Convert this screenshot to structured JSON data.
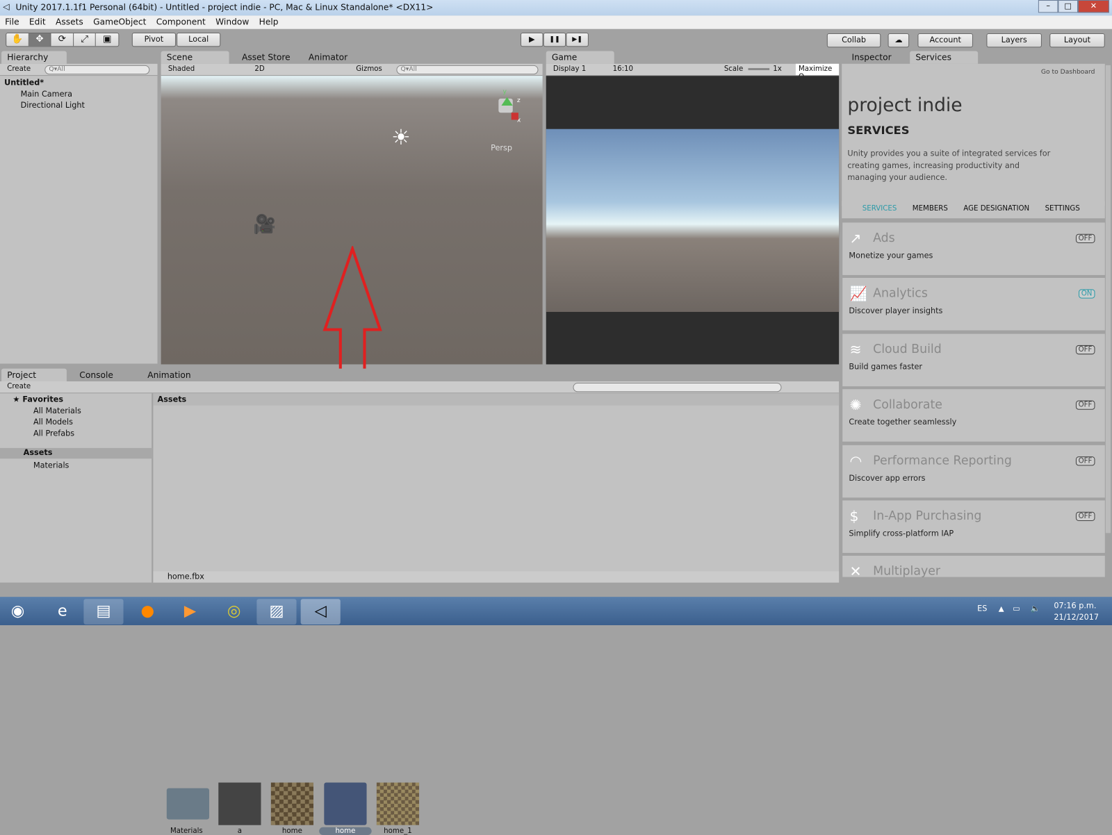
{
  "window": {
    "title": "Unity 2017.1.1f1 Personal (64bit) - Untitled - project indie - PC, Mac & Linux Standalone* <DX11>",
    "controls": [
      "–",
      "□",
      "✕"
    ]
  },
  "menu": [
    "File",
    "Edit",
    "Assets",
    "GameObject",
    "Component",
    "Window",
    "Help"
  ],
  "toolbar": {
    "tools": [
      "✋",
      "✥",
      "⟳",
      "⤢",
      "▣"
    ],
    "pivot": "Pivot",
    "local": "Local",
    "play": "▶",
    "pause": "❚❚",
    "step": "▶❚",
    "collab": "Collab",
    "cloud": "☁",
    "account": "Account",
    "layers": "Layers",
    "layout": "Layout"
  },
  "hierarchy": {
    "tab": "Hierarchy",
    "create": "Create",
    "search": "Q▾All",
    "scene": "Untitled*",
    "items": [
      "Main Camera",
      "Directional Light"
    ]
  },
  "scene": {
    "tabs": [
      "Scene",
      "Asset Store",
      "Animator"
    ],
    "shading": "Shaded",
    "mode2d": "2D",
    "gizmos": "Gizmos",
    "search": "Q▾All",
    "persp": "Persp",
    "axes": {
      "y": "y",
      "z": "z",
      "x": "x"
    }
  },
  "game": {
    "tab": "Game",
    "display": "Display 1",
    "aspect": "16:10",
    "scale_label": "Scale",
    "scale_value": "1x",
    "maximize": "Maximize O"
  },
  "project": {
    "tabs": [
      "Project",
      "Console",
      "Animation"
    ],
    "create": "Create",
    "favorites": "Favorites",
    "fav_items": [
      "All Materials",
      "All Models",
      "All Prefabs"
    ],
    "assets_root": "Assets",
    "folders": [
      "Materials"
    ],
    "breadcrumb": "Assets",
    "assets": [
      {
        "name": "Materials",
        "kind": "folder"
      },
      {
        "name": "a",
        "kind": "texture"
      },
      {
        "name": "home",
        "kind": "texture"
      },
      {
        "name": "home",
        "kind": "model",
        "selected": true
      },
      {
        "name": "home_1",
        "kind": "texture"
      }
    ],
    "status": "home.fbx"
  },
  "services": {
    "tabs": [
      "Inspector",
      "Services"
    ],
    "dashboard": "Go to Dashboard",
    "project": "project indie",
    "heading": "SERVICES",
    "description": "Unity provides you a suite of integrated services for creating games, increasing productivity and managing your audience.",
    "nav": [
      "SERVICES",
      "MEMBERS",
      "AGE DESIGNATION",
      "SETTINGS"
    ],
    "accent": "#2a9aa8",
    "cards": [
      {
        "name": "Ads",
        "desc": "Monetize your games",
        "state": "OFF",
        "icon": "ads-icon",
        "glyph": "↗"
      },
      {
        "name": "Analytics",
        "desc": "Discover player insights",
        "state": "ON",
        "icon": "analytics-icon",
        "glyph": "📈"
      },
      {
        "name": "Cloud Build",
        "desc": "Build games faster",
        "state": "OFF",
        "icon": "cloud-build-icon",
        "glyph": "≋"
      },
      {
        "name": "Collaborate",
        "desc": "Create together seamlessly",
        "state": "OFF",
        "icon": "collaborate-icon",
        "glyph": "✺"
      },
      {
        "name": "Performance Reporting",
        "desc": "Discover app errors",
        "state": "OFF",
        "icon": "performance-icon",
        "glyph": "◠"
      },
      {
        "name": "In-App Purchasing",
        "desc": "Simplify cross-platform IAP",
        "state": "OFF",
        "icon": "iap-icon",
        "glyph": "$"
      },
      {
        "name": "Multiplayer",
        "desc": "",
        "state": "",
        "icon": "multiplayer-icon",
        "glyph": "✕"
      }
    ]
  },
  "taskbar": {
    "lang": "ES",
    "time": "07:16 p.m.",
    "date": "21/12/2017",
    "apps": [
      "ie-icon",
      "explorer-icon",
      "firefox-icon",
      "media-player-icon",
      "chrome-icon",
      "photos-icon",
      "unity-icon"
    ]
  }
}
